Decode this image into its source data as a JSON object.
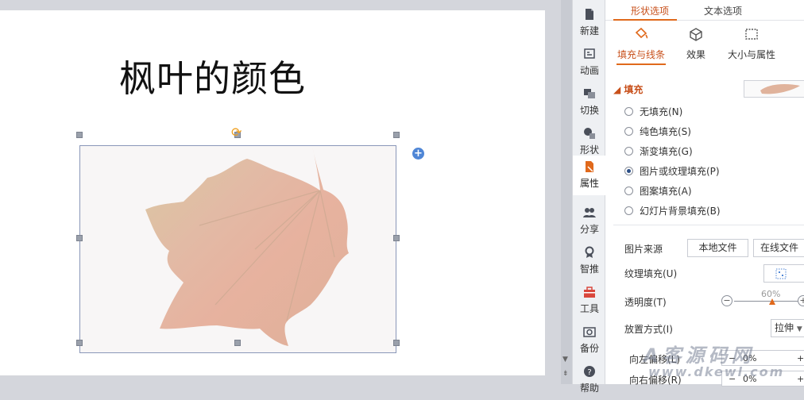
{
  "slide": {
    "title": "枫叶的颜色"
  },
  "sidebar": {
    "items": [
      {
        "label": "新建",
        "icon": "new-file-icon"
      },
      {
        "label": "动画",
        "icon": "animation-icon"
      },
      {
        "label": "切换",
        "icon": "transition-icon"
      },
      {
        "label": "形状",
        "icon": "shapes-icon"
      },
      {
        "label": "属性",
        "icon": "properties-icon"
      },
      {
        "label": "分享",
        "icon": "share-icon"
      },
      {
        "label": "智推",
        "icon": "smart-recommend-icon"
      },
      {
        "label": "工具",
        "icon": "toolbox-icon"
      },
      {
        "label": "备份",
        "icon": "backup-icon"
      },
      {
        "label": "帮助",
        "icon": "help-icon"
      }
    ],
    "active_index": 4
  },
  "panel": {
    "tabs": [
      "形状选项",
      "文本选项"
    ],
    "active_tab": 0,
    "subtabs": [
      {
        "label": "填充与线条",
        "icon": "paint-bucket-icon"
      },
      {
        "label": "效果",
        "icon": "cube-icon"
      },
      {
        "label": "大小与属性",
        "icon": "size-icon"
      }
    ],
    "active_subtab": 0,
    "fill_section": "填充",
    "fill_options": [
      {
        "label": "无填充(N)",
        "checked": false
      },
      {
        "label": "纯色填充(S)",
        "checked": false
      },
      {
        "label": "渐变填充(G)",
        "checked": false
      },
      {
        "label": "图片或纹理填充(P)",
        "checked": true
      },
      {
        "label": "图案填充(A)",
        "checked": false
      },
      {
        "label": "幻灯片背景填充(B)",
        "checked": false
      }
    ],
    "image_source_label": "图片来源",
    "local_file_button": "本地文件",
    "online_file_button": "在线文件",
    "texture_fill_label": "纹理填充(U)",
    "transparency_label": "透明度(T)",
    "transparency_value": "60%",
    "transparency_fraction": 0.6,
    "placement_label": "放置方式(I)",
    "placement_value": "拉伸",
    "offset_left_label": "向左偏移(L)",
    "offset_left_value": "0%",
    "offset_right_label": "向右偏移(R)",
    "offset_right_value": "0%"
  },
  "watermark": {
    "line1": "A客源码网",
    "line2": "www.dkewl.com"
  },
  "colors": {
    "accent": "#e0691c",
    "accent_text": "#c8501b",
    "radio_checked": "#2b4e86"
  }
}
